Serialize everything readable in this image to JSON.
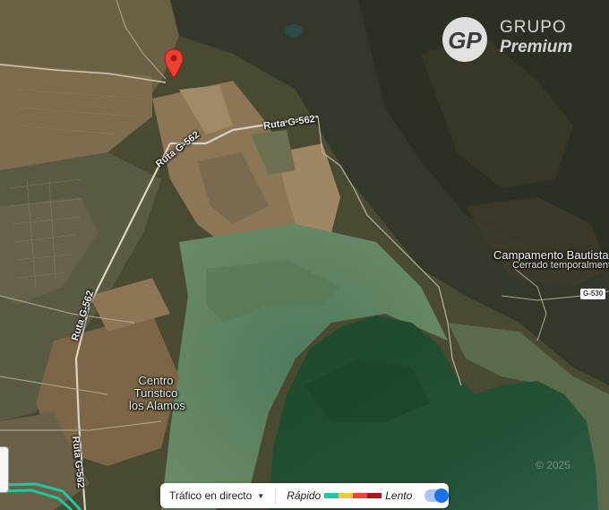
{
  "map": {
    "roads": [
      {
        "label": "Ruta G-562",
        "orientation": "horizontal"
      },
      {
        "label": "Ruta G-562",
        "orientation": "diagonal"
      },
      {
        "label": "Ruta G-562",
        "orientation": "vertical-upper"
      },
      {
        "label": "Ruta G-562",
        "orientation": "vertical-lower"
      }
    ],
    "shield": "G-530",
    "places": {
      "camp_name": "Campamento Bautista",
      "camp_status": "Cerrado temporalmente",
      "center_line1": "Centro",
      "center_line2": "Turistico",
      "center_line3": "los Alamos"
    },
    "pin_color": "#ea4335",
    "icons": [
      "location-pin-icon",
      "chevron-down-icon",
      "toggle-switch"
    ]
  },
  "watermark": {
    "logo": "GP",
    "line1": "GRUPO",
    "line2": "Premium"
  },
  "copyright": "© 2025",
  "traffic": {
    "live_label": "Tráfico en directo",
    "fast_label": "Rápido",
    "slow_label": "Lento",
    "colors": [
      "#1fc8a0",
      "#f4c542",
      "#e8453c",
      "#a8191e"
    ],
    "toggle_on": true
  }
}
